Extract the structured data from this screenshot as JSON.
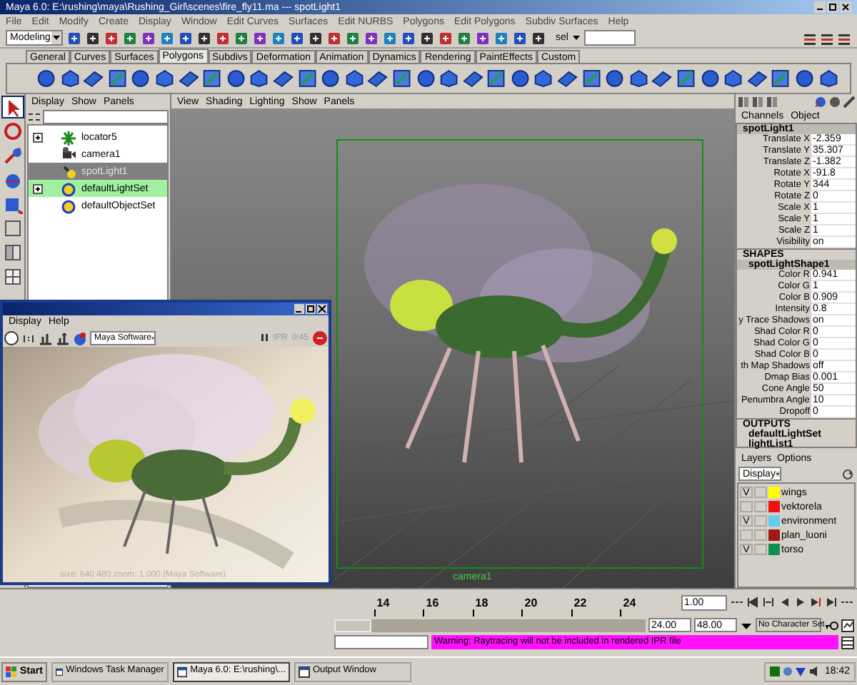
{
  "window": {
    "title": "Maya 6.0: E:\\rushing\\maya\\Rushing_Girl\\scenes\\fire_fly11.ma  ---  spotLight1"
  },
  "menu": [
    "File",
    "Edit",
    "Modify",
    "Create",
    "Display",
    "Window",
    "Edit Curves",
    "Surfaces",
    "Edit NURBS",
    "Polygons",
    "Edit Polygons",
    "Subdiv Surfaces",
    "Help"
  ],
  "status_line": {
    "mode": "Modeling",
    "sel_label": "sel"
  },
  "shelf_tabs": [
    {
      "label": "General",
      "selected": false
    },
    {
      "label": "Curves",
      "selected": false
    },
    {
      "label": "Surfaces",
      "selected": false
    },
    {
      "label": "Polygons",
      "selected": true
    },
    {
      "label": "Subdivs",
      "selected": false
    },
    {
      "label": "Deformation",
      "selected": false
    },
    {
      "label": "Animation",
      "selected": false
    },
    {
      "label": "Dynamics",
      "selected": false
    },
    {
      "label": "Rendering",
      "selected": false
    },
    {
      "label": "PaintEffects",
      "selected": false
    },
    {
      "label": "Custom",
      "selected": false
    }
  ],
  "outliner": {
    "menu": [
      "Display",
      "Show",
      "Panels"
    ],
    "items": [
      {
        "label": "locator5",
        "expandable": true,
        "selected": false,
        "highlighted": false
      },
      {
        "label": "camera1",
        "expandable": false,
        "selected": false,
        "highlighted": false
      },
      {
        "label": "spotLight1",
        "expandable": false,
        "selected": true,
        "highlighted": false
      },
      {
        "label": "defaultLightSet",
        "expandable": true,
        "selected": false,
        "highlighted": true
      },
      {
        "label": "defaultObjectSet",
        "expandable": false,
        "selected": false,
        "highlighted": false
      }
    ]
  },
  "viewport": {
    "menu": [
      "View",
      "Shading",
      "Lighting",
      "Show",
      "Panels"
    ],
    "camera_label": "camera1"
  },
  "channel_box": {
    "tabs": [
      "Channels",
      "Object"
    ],
    "node": "spotLight1",
    "attributes": [
      {
        "label": "Translate X",
        "value": "-2.359"
      },
      {
        "label": "Translate Y",
        "value": "35.307"
      },
      {
        "label": "Translate Z",
        "value": "-1.382"
      },
      {
        "label": "Rotate X",
        "value": "-91.8"
      },
      {
        "label": "Rotate Y",
        "value": "344"
      },
      {
        "label": "Rotate Z",
        "value": "0"
      },
      {
        "label": "Scale X",
        "value": "1"
      },
      {
        "label": "Scale Y",
        "value": "1"
      },
      {
        "label": "Scale Z",
        "value": "1"
      },
      {
        "label": "Visibility",
        "value": "on"
      }
    ],
    "shapes_header": "SHAPES",
    "shape_node": "spotLightShape1",
    "shape_attributes": [
      {
        "label": "Color R",
        "value": "0.941"
      },
      {
        "label": "Color G",
        "value": "1"
      },
      {
        "label": "Color B",
        "value": "0.909"
      },
      {
        "label": "Intensity",
        "value": "0.8"
      },
      {
        "label": "y Trace Shadows",
        "value": "on"
      },
      {
        "label": "Shad Color R",
        "value": "0"
      },
      {
        "label": "Shad Color G",
        "value": "0"
      },
      {
        "label": "Shad Color B",
        "value": "0"
      },
      {
        "label": "th Map Shadows",
        "value": "off"
      },
      {
        "label": "Dmap Bias",
        "value": "0.001"
      },
      {
        "label": "Cone Angle",
        "value": "50"
      },
      {
        "label": "Penumbra Angle",
        "value": "10"
      },
      {
        "label": "Dropoff",
        "value": "0"
      }
    ],
    "outputs_header": "OUTPUTS",
    "outputs": [
      "defaultLightSet",
      "lightList1"
    ]
  },
  "layers": {
    "menu": [
      "Layers",
      "Options"
    ],
    "mode": "Display",
    "items": [
      {
        "name": "wings",
        "toggle": "V",
        "color": "#ffff00"
      },
      {
        "name": "vektorela",
        "color": "#ee1111"
      },
      {
        "name": "environment",
        "toggle": "V",
        "color": "#66ccee"
      },
      {
        "name": "plan_luoni",
        "color": "#a01818"
      },
      {
        "name": "torso",
        "toggle": "V",
        "color": "#109050"
      }
    ]
  },
  "render_view": {
    "menu": [
      "Display",
      "Help"
    ],
    "renderer": "Maya Software",
    "ipr_labels": [
      "IPR",
      "0:45"
    ],
    "footer": "size: 640  480  zoom: 1.000  (Maya Software)"
  },
  "timeline": {
    "ticks": [
      "14",
      "16",
      "18",
      "20",
      "22",
      "24"
    ],
    "current_time": "1.00"
  },
  "range": {
    "level": 0.12,
    "start": "24.00",
    "end": "48.00",
    "character_set": "No Character Set"
  },
  "command_line": {
    "message": "Warning: Raytracing will not be included in rendered IPR file"
  },
  "taskbar": {
    "start": "Start",
    "tasks": [
      {
        "label": "Windows Task Manager",
        "selected": false
      },
      {
        "label": "Maya 6.0: E:\\rushing\\...",
        "selected": true
      },
      {
        "label": "Output Window",
        "selected": false
      }
    ],
    "clock": "18:42"
  }
}
